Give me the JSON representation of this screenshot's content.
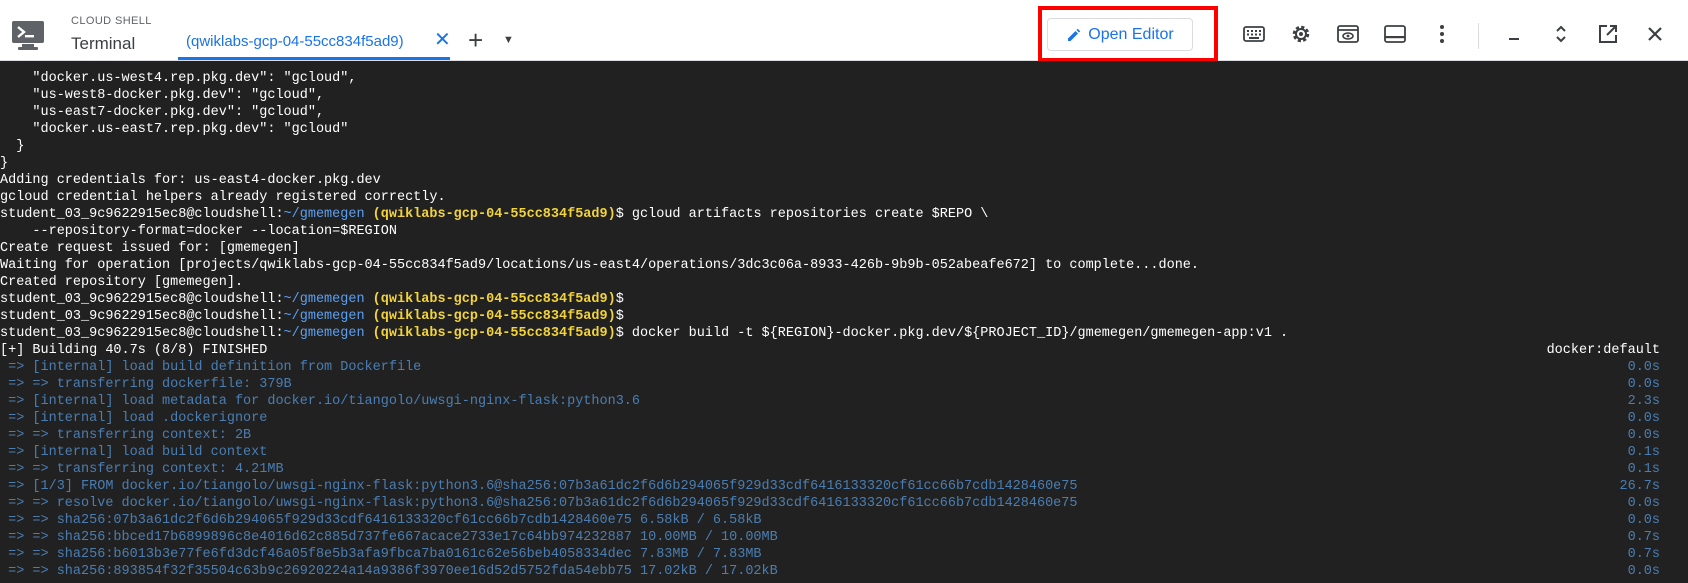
{
  "header": {
    "shell_label": "CLOUD SHELL",
    "title": "Terminal",
    "tab_label": "(qwiklabs-gcp-04-55cc834f5ad9)",
    "close_glyph": "✕",
    "add_glyph": "+",
    "menu_glyph": "▼",
    "open_editor_label": "Open Editor",
    "highlight_color": "#ff0000",
    "accent_color": "#1a73e8",
    "tools": [
      "keyboard-icon",
      "gear-icon",
      "web-preview-icon",
      "panel-icon",
      "more-vert-icon",
      "minimize-icon",
      "restore-icon",
      "open-new-window-icon",
      "close-icon"
    ]
  },
  "terminal": {
    "prompt_user": "student_03_9c9622915ec8@cloudshell:",
    "prompt_path": "~/gmemegen",
    "prompt_project": "(qwiklabs-gcp-04-55cc834f5ad9)",
    "lines": [
      "    \"docker.us-west4.rep.pkg.dev\": \"gcloud\",",
      "    \"us-west8-docker.pkg.dev\": \"gcloud\",",
      "    \"us-east7-docker.pkg.dev\": \"gcloud\",",
      "    \"docker.us-east7.rep.pkg.dev\": \"gcloud\"",
      "  }",
      "}",
      "Adding credentials for: us-east4-docker.pkg.dev",
      "gcloud credential helpers already registered correctly."
    ],
    "cmd1": "$ gcloud artifacts repositories create $REPO \\",
    "cmd1_cont": "    --repository-format=docker --location=$REGION",
    "out1": [
      "Create request issued for: [gmemegen]",
      "Waiting for operation [projects/qwiklabs-gcp-04-55cc834f5ad9/locations/us-east4/operations/3dc3c06a-8933-426b-9b9b-052abeafe672] to complete...done.",
      "Created repository [gmemegen]."
    ],
    "empty_cmd": "$",
    "cmd2": "$ docker build -t ${REGION}-docker.pkg.dev/${PROJECT_ID}/gmemegen/gmemegen-app:v1 .",
    "build_header": "[+] Building 40.7s (8/8) FINISHED",
    "build_header_right": "docker:default",
    "build_steps": [
      {
        "text": " => [internal] load build definition from Dockerfile",
        "time": "0.0s"
      },
      {
        "text": " => => transferring dockerfile: 379B",
        "time": "0.0s"
      },
      {
        "text": " => [internal] load metadata for docker.io/tiangolo/uwsgi-nginx-flask:python3.6",
        "time": "2.3s"
      },
      {
        "text": " => [internal] load .dockerignore",
        "time": "0.0s"
      },
      {
        "text": " => => transferring context: 2B",
        "time": "0.0s"
      },
      {
        "text": " => [internal] load build context",
        "time": "0.1s"
      },
      {
        "text": " => => transferring context: 4.21MB",
        "time": "0.1s"
      },
      {
        "text": " => [1/3] FROM docker.io/tiangolo/uwsgi-nginx-flask:python3.6@sha256:07b3a61dc2f6d6b294065f929d33cdf6416133320cf61cc66b7cdb1428460e75",
        "time": "26.7s"
      },
      {
        "text": " => => resolve docker.io/tiangolo/uwsgi-nginx-flask:python3.6@sha256:07b3a61dc2f6d6b294065f929d33cdf6416133320cf61cc66b7cdb1428460e75",
        "time": "0.0s"
      },
      {
        "text": " => => sha256:07b3a61dc2f6d6b294065f929d33cdf6416133320cf61cc66b7cdb1428460e75 6.58kB / 6.58kB",
        "time": "0.0s"
      },
      {
        "text": " => => sha256:bbced17b6899896c8e4016d62c885d737fe667acace2733e17c64bb974232887 10.00MB / 10.00MB",
        "time": "0.7s"
      },
      {
        "text": " => => sha256:b6013b3e77fe6fd3dcf46a05f8e5b3afa9fbca7ba0161c62e56beb4058334dec 7.83MB / 7.83MB",
        "time": "0.7s"
      },
      {
        "text": " => => sha256:893854f32f35504c63b9c26920224a14a9386f3970ee16d52d5752fda54ebb75 17.02kB / 17.02kB",
        "time": "0.0s"
      }
    ]
  }
}
